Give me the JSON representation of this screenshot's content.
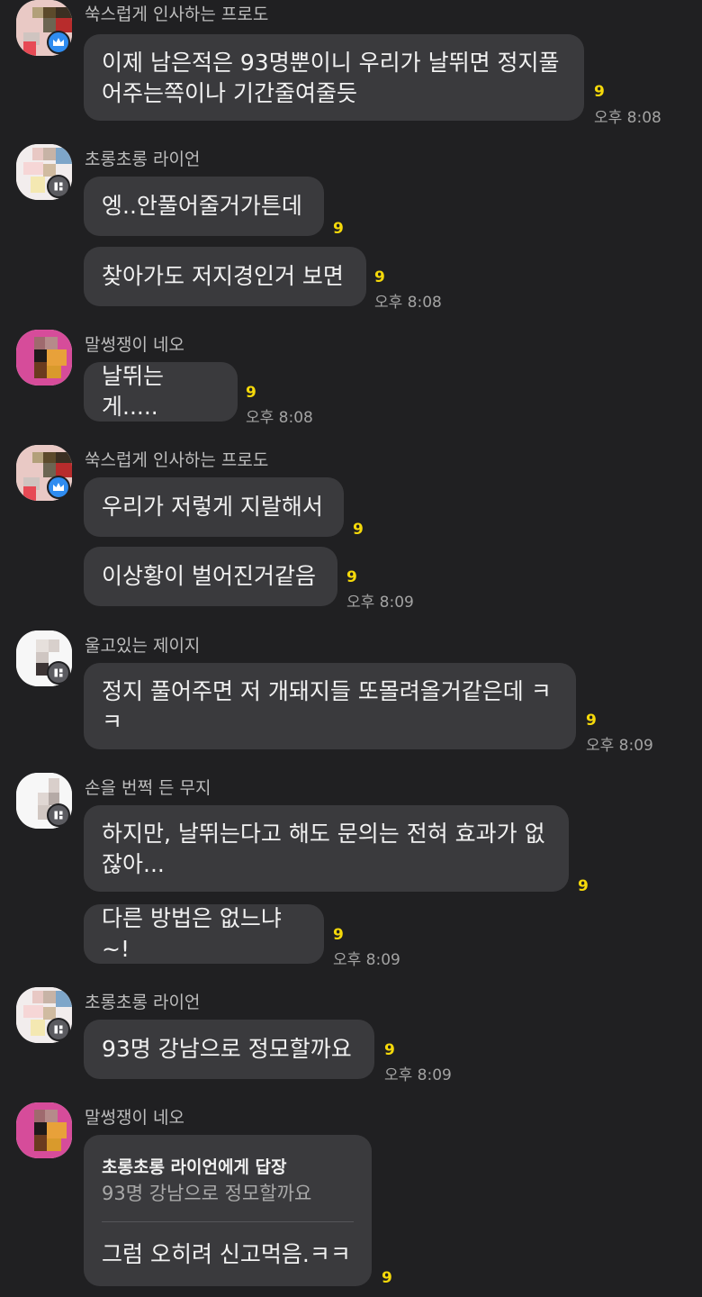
{
  "messages": [
    {
      "sender": "쑥스럽게 인사하는 프로도",
      "lines": [
        "이제 남은적은 93명뿐이니 우리가 날뛰면 정지풀",
        "어주는쪽이나 기간줄여줄듯"
      ],
      "unread": "9",
      "time": "오후 8:08"
    },
    {
      "sender": "초롱초롱 라이언",
      "lines": [
        "엥..안풀어줄거가튼데"
      ],
      "unread": "9",
      "time": ""
    },
    {
      "sender": "",
      "lines": [
        "찾아가도 저지경인거 보면"
      ],
      "unread": "9",
      "time": "오후 8:08"
    },
    {
      "sender": "말썽쟁이 네오",
      "lines": [
        "날뛰는게....."
      ],
      "unread": "9",
      "time": "오후 8:08"
    },
    {
      "sender": "쑥스럽게 인사하는 프로도",
      "lines": [
        "우리가 저렇게 지랄해서"
      ],
      "unread": "9",
      "time": ""
    },
    {
      "sender": "",
      "lines": [
        "이상황이 벌어진거같음"
      ],
      "unread": "9",
      "time": "오후 8:09"
    },
    {
      "sender": "울고있는 제이지",
      "lines": [
        "정지 풀어주면 저 개돼지들 또몰려올거같은데 ㅋ",
        "ㅋ"
      ],
      "unread": "9",
      "time": "오후 8:09"
    },
    {
      "sender": "손을 번쩍 든 무지",
      "lines": [
        "하지만, 날뛰는다고 해도 문의는 전혀 효과가 없",
        "잖아..."
      ],
      "unread": "9",
      "time": ""
    },
    {
      "sender": "",
      "lines": [
        "다른 방법은 없느냐~!"
      ],
      "unread": "9",
      "time": "오후 8:09"
    },
    {
      "sender": "초롱초롱 라이언",
      "lines": [
        "93명 강남으로 정모할까요"
      ],
      "unread": "9",
      "time": "오후 8:09"
    }
  ],
  "reply": {
    "sender": "말썽쟁이 네오",
    "title": "초롱초롱 라이언에게 답장",
    "quote": "93명 강남으로 정모할까요",
    "text": "그럼 오히려 신고먹음.ㅋㅋ",
    "unread": "9"
  },
  "icons": {
    "crown_badge": "crown-icon",
    "host_badge": "host-icon"
  },
  "colors": {
    "background": "#202022",
    "bubble": "#3a3a3d",
    "unread": "#f5d90a",
    "crown_badge": "#2f8cf0"
  }
}
